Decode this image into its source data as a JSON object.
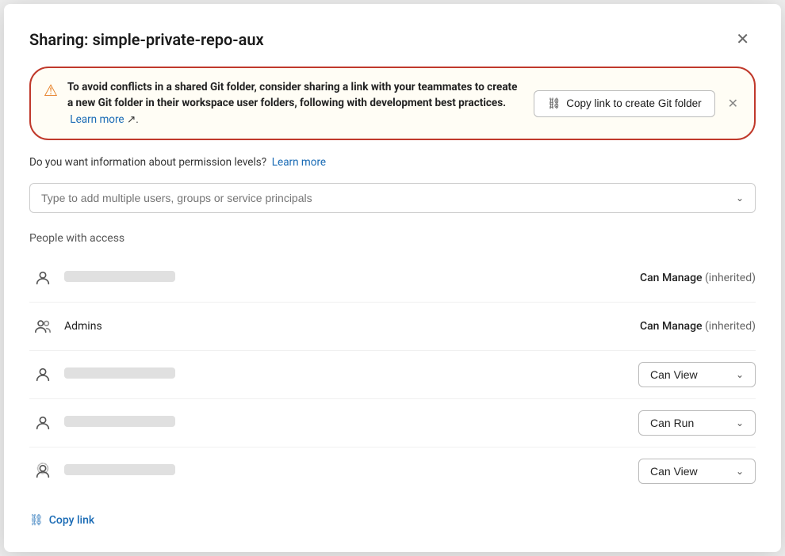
{
  "modal": {
    "title": "Sharing: simple-private-repo-aux"
  },
  "warning": {
    "icon": "⚠",
    "text_strong": "To avoid conflicts in a shared Git folder, consider sharing a link with your teammates to create a new Git folder in their workspace user folders, following with development best practices.",
    "text_learn_more": "Learn more",
    "learn_more_link": "#",
    "close_icon": "✕",
    "copy_button_label": "Copy link to create Git folder",
    "link_icon": "🔗"
  },
  "permission_info": {
    "text": "Do you want information about permission levels?",
    "learn_more": "Learn more"
  },
  "search": {
    "placeholder": "Type to add multiple users, groups or service principals"
  },
  "people_section": {
    "label": "People with access"
  },
  "people": [
    {
      "id": 1,
      "icon_type": "person",
      "name_blurred": true,
      "name": "",
      "permission_text": "Can Manage",
      "inherited": "(inherited)",
      "has_dropdown": false
    },
    {
      "id": 2,
      "icon_type": "group",
      "name_blurred": false,
      "name": "Admins",
      "permission_text": "Can Manage",
      "inherited": "(inherited)",
      "has_dropdown": false
    },
    {
      "id": 3,
      "icon_type": "person",
      "name_blurred": true,
      "name": "",
      "permission_text": "Can View",
      "inherited": "",
      "has_dropdown": true
    },
    {
      "id": 4,
      "icon_type": "person",
      "name_blurred": true,
      "name": "",
      "permission_text": "Can Run",
      "inherited": "",
      "has_dropdown": true
    },
    {
      "id": 5,
      "icon_type": "person-outline",
      "name_blurred": true,
      "name": "",
      "permission_text": "Can View",
      "inherited": "",
      "has_dropdown": true
    }
  ],
  "footer": {
    "copy_link_label": "Copy link"
  },
  "icons": {
    "person": "👤",
    "group": "👥",
    "close": "✕",
    "chevron_down": "⌄",
    "link": "🔗"
  }
}
